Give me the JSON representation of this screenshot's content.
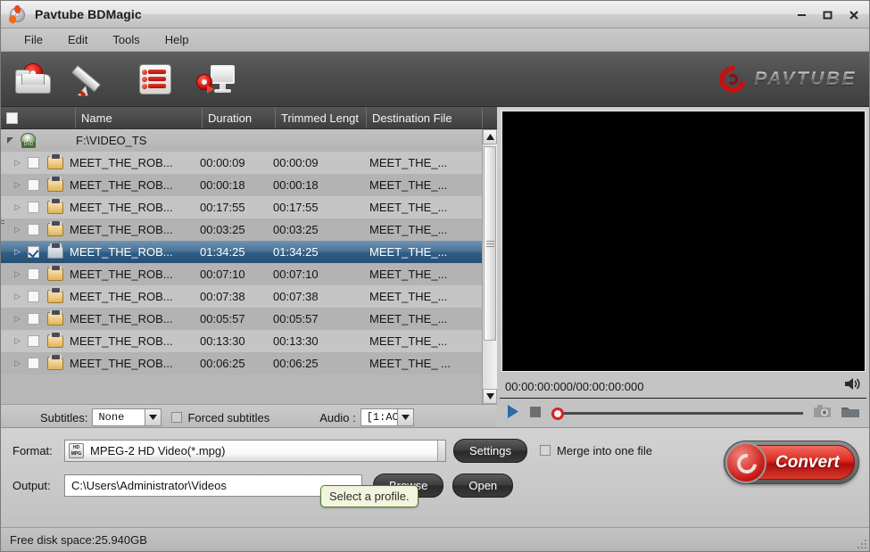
{
  "window": {
    "title": "Pavtube BDMagic",
    "app_icon": "disc-burn-icon",
    "minimize": "minimize-icon",
    "maximize": "maximize-icon",
    "close": "close-icon"
  },
  "menu": {
    "items": [
      {
        "label": "File"
      },
      {
        "label": "Edit"
      },
      {
        "label": "Tools"
      },
      {
        "label": "Help"
      }
    ]
  },
  "toolbar": {
    "buttons": [
      {
        "name": "load-disc-icon"
      },
      {
        "name": "edit-pencil-icon"
      },
      {
        "name": "add-from-list-icon"
      },
      {
        "name": "disc-to-monitor-icon"
      }
    ],
    "brand": "PAVTUBE"
  },
  "file_list": {
    "columns": [
      "Name",
      "Duration",
      "Trimmed Lengt",
      "Destination File"
    ],
    "header_checkbox_checked": false,
    "root": {
      "path": "F:\\VIDEO_TS",
      "icon": "dvd-disc-icon",
      "expanded": true
    },
    "rows": [
      {
        "name": "MEET_THE_ROB...",
        "duration": "00:00:09",
        "trimmed": "00:00:09",
        "destination": "MEET_THE_...",
        "checked": false,
        "selected": false
      },
      {
        "name": "MEET_THE_ROB...",
        "duration": "00:00:18",
        "trimmed": "00:00:18",
        "destination": "MEET_THE_...",
        "checked": false,
        "selected": false
      },
      {
        "name": "MEET_THE_ROB...",
        "duration": "00:17:55",
        "trimmed": "00:17:55",
        "destination": "MEET_THE_...",
        "checked": false,
        "selected": false
      },
      {
        "name": "MEET_THE_ROB...",
        "duration": "00:03:25",
        "trimmed": "00:03:25",
        "destination": "MEET_THE_...",
        "checked": false,
        "selected": false
      },
      {
        "name": "MEET_THE_ROB...",
        "duration": "01:34:25",
        "trimmed": "01:34:25",
        "destination": "MEET_THE_...",
        "checked": true,
        "selected": true
      },
      {
        "name": "MEET_THE_ROB...",
        "duration": "00:07:10",
        "trimmed": "00:07:10",
        "destination": "MEET_THE_...",
        "checked": false,
        "selected": false
      },
      {
        "name": "MEET_THE_ROB...",
        "duration": "00:07:38",
        "trimmed": "00:07:38",
        "destination": "MEET_THE_...",
        "checked": false,
        "selected": false
      },
      {
        "name": "MEET_THE_ROB...",
        "duration": "00:05:57",
        "trimmed": "00:05:57",
        "destination": "MEET_THE_...",
        "checked": false,
        "selected": false
      },
      {
        "name": "MEET_THE_ROB...",
        "duration": "00:13:30",
        "trimmed": "00:13:30",
        "destination": "MEET_THE_...",
        "checked": false,
        "selected": false
      },
      {
        "name": "MEET_THE_ROB...",
        "duration": "00:06:25",
        "trimmed": "00:06:25",
        "destination": "MEET_THE_ ...",
        "checked": false,
        "selected": false
      }
    ]
  },
  "track_bar": {
    "subtitles_label": "Subtitles:",
    "subtitles_value": "None",
    "forced_label": "Forced subtitles",
    "forced_checked": false,
    "audio_label": "Audio :",
    "audio_value": "[1:AC"
  },
  "list_actions": [
    {
      "name": "move-up-icon"
    },
    {
      "name": "move-down-icon"
    },
    {
      "name": "remove-icon"
    },
    {
      "name": "clear-all-icon"
    },
    {
      "name": "split-merge-icon"
    }
  ],
  "preview": {
    "time_display": "00:00:00:000/00:00:00:000",
    "volume_icon": "speaker-icon",
    "play_icon": "play-icon",
    "stop_icon": "stop-icon",
    "snapshot_icon": "camera-icon",
    "open_folder_icon": "folder-icon",
    "seek_position_percent": 0
  },
  "bottom": {
    "format_label": "Format:",
    "format_value": "MPEG-2 HD Video(*.mpg)",
    "format_icon_top": "HD",
    "format_icon_bottom": "MPG",
    "settings_label": "Settings",
    "merge_label": "Merge into one file",
    "merge_checked": false,
    "output_label": "Output:",
    "output_value": "C:\\Users\\Administrator\\Videos",
    "browse_label": "Browse",
    "open_label": "Open",
    "convert_label": "Convert"
  },
  "tooltip": {
    "text": "Select a profile."
  },
  "status": {
    "text": "Free disk space:25.940GB"
  },
  "colors": {
    "accent_red": "#cc0000",
    "selection_blue": "#2f5d85",
    "toolbar_dark": "#4e4e4e",
    "tooltip_bg": "#f3f4dd"
  }
}
